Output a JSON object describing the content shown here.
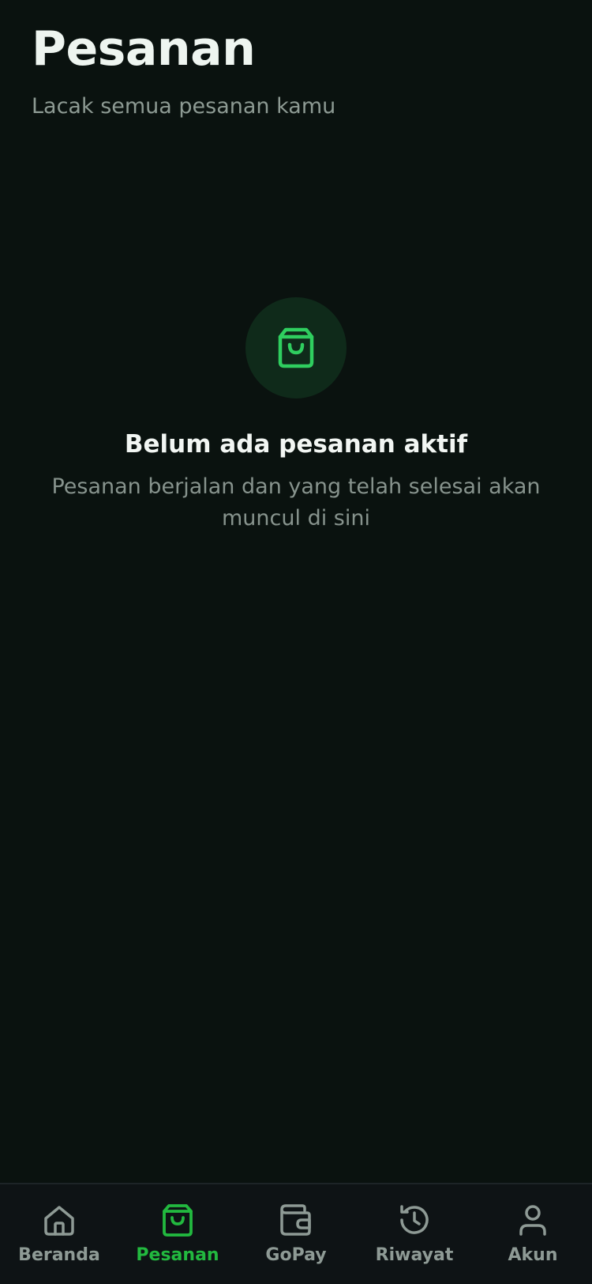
{
  "header": {
    "title": "Pesanan",
    "subtitle": "Lacak semua pesanan kamu"
  },
  "empty_state": {
    "icon": "shopping-bag-icon",
    "title": "Belum ada pesanan aktif",
    "description": "Pesanan berjalan dan yang telah selesai akan muncul di sini"
  },
  "nav": {
    "items": [
      {
        "label": "Beranda",
        "icon": "home-icon",
        "active": false
      },
      {
        "label": "Pesanan",
        "icon": "shopping-bag-icon",
        "active": true
      },
      {
        "label": "GoPay",
        "icon": "wallet-icon",
        "active": false
      },
      {
        "label": "Riwayat",
        "icon": "history-icon",
        "active": false
      },
      {
        "label": "Akun",
        "icon": "user-icon",
        "active": false
      }
    ]
  },
  "colors": {
    "background": "#0a120f",
    "accent": "#22b93f",
    "empty_icon": "#2fce5f",
    "empty_icon_bg": "#0f2a1a",
    "nav_inactive": "#8e9a95"
  }
}
